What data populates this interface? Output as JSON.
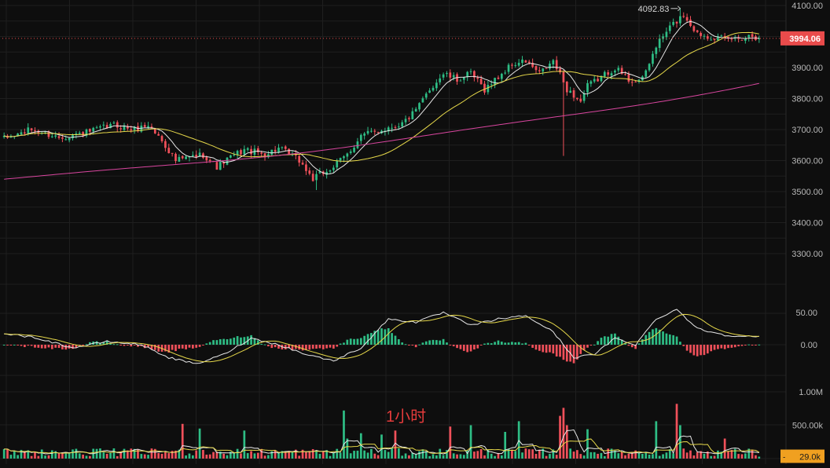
{
  "colors": {
    "background": "#0e0e0e",
    "grid": "#1f1f1f",
    "axis_text": "#b8b8b8",
    "up": "#2ebd85",
    "down": "#f0505a",
    "ma_fast": "#e8e8e8",
    "ma_mid": "#e6d84a",
    "ma_slow": "#d9469f",
    "price_tag": "#e94b4b",
    "volume_tag": "#f0a020",
    "annotation": "#e33b3b"
  },
  "chart_data": [
    {
      "type": "candlestick",
      "panel": "price",
      "y_ticks": [
        "4100.00",
        "4000.00",
        "3900.00",
        "3800.00",
        "3700.00",
        "3600.00",
        "3500.00",
        "3400.00",
        "3300.00"
      ],
      "ylim": [
        3215,
        4100
      ],
      "grid": true,
      "high_marker_label": "4092.83",
      "last_price_label": "3994.06",
      "anchors": [
        [
          0,
          3670
        ],
        [
          8,
          3700
        ],
        [
          16,
          3675
        ],
        [
          24,
          3690
        ],
        [
          32,
          3715
        ],
        [
          38,
          3700
        ],
        [
          42,
          3715
        ],
        [
          46,
          3665
        ],
        [
          50,
          3600
        ],
        [
          54,
          3610
        ],
        [
          58,
          3620
        ],
        [
          62,
          3580
        ],
        [
          66,
          3610
        ],
        [
          70,
          3635
        ],
        [
          76,
          3620
        ],
        [
          80,
          3640
        ],
        [
          86,
          3600
        ],
        [
          90,
          3540
        ],
        [
          96,
          3580
        ],
        [
          100,
          3620
        ],
        [
          104,
          3680
        ],
        [
          110,
          3700
        ],
        [
          116,
          3720
        ],
        [
          120,
          3760
        ],
        [
          124,
          3830
        ],
        [
          128,
          3880
        ],
        [
          132,
          3860
        ],
        [
          136,
          3880
        ],
        [
          140,
          3830
        ],
        [
          144,
          3870
        ],
        [
          148,
          3910
        ],
        [
          152,
          3920
        ],
        [
          156,
          3880
        ],
        [
          160,
          3920
        ],
        [
          164,
          3830
        ],
        [
          168,
          3790
        ],
        [
          170,
          3840
        ],
        [
          174,
          3870
        ],
        [
          178,
          3900
        ],
        [
          182,
          3860
        ],
        [
          186,
          3860
        ],
        [
          190,
          3970
        ],
        [
          194,
          4030
        ],
        [
          198,
          4070
        ],
        [
          202,
          4010
        ],
        [
          206,
          4000
        ],
        [
          210,
          3990
        ],
        [
          214,
          3995
        ],
        [
          218,
          4005
        ],
        [
          220,
          3994.06
        ]
      ],
      "n_bars": 221,
      "special_wicks": [
        {
          "bar": 163,
          "low": 3615
        },
        {
          "bar": 91,
          "low": 3505
        },
        {
          "bar": 197,
          "high": 4092.83
        }
      ],
      "moving_averages": [
        {
          "kind": "fast",
          "period": 7
        },
        {
          "kind": "mid",
          "period": 25
        },
        {
          "kind": "slow",
          "period": 99,
          "start": 3540,
          "end": 3850
        }
      ]
    },
    {
      "type": "macd",
      "panel": "macd",
      "y_ticks": [
        "50.00",
        "0.00"
      ],
      "ylim": [
        -55,
        80
      ],
      "anchors": [
        [
          0,
          18
        ],
        [
          10,
          10
        ],
        [
          20,
          -5
        ],
        [
          30,
          5
        ],
        [
          40,
          0
        ],
        [
          48,
          -20
        ],
        [
          56,
          -30
        ],
        [
          64,
          -15
        ],
        [
          72,
          10
        ],
        [
          80,
          0
        ],
        [
          88,
          -15
        ],
        [
          96,
          -25
        ],
        [
          104,
          -5
        ],
        [
          112,
          40
        ],
        [
          120,
          35
        ],
        [
          128,
          50
        ],
        [
          136,
          30
        ],
        [
          144,
          40
        ],
        [
          152,
          45
        ],
        [
          160,
          20
        ],
        [
          166,
          -20
        ],
        [
          172,
          -15
        ],
        [
          178,
          10
        ],
        [
          184,
          0
        ],
        [
          190,
          40
        ],
        [
          196,
          55
        ],
        [
          202,
          25
        ],
        [
          210,
          15
        ],
        [
          220,
          12
        ]
      ]
    },
    {
      "type": "bar",
      "panel": "volume",
      "y_ticks": [
        "1.00M",
        "500.00k"
      ],
      "ylim": [
        0,
        1150000
      ],
      "last_volume_label": "29.0k",
      "annotation": "1小时",
      "base_volume": 90000,
      "spikes": [
        [
          52,
          520000
        ],
        [
          57,
          450000
        ],
        [
          70,
          420000
        ],
        [
          99,
          720000
        ],
        [
          100,
          300000
        ],
        [
          104,
          380000
        ],
        [
          110,
          360000
        ],
        [
          114,
          420000
        ],
        [
          130,
          480000
        ],
        [
          136,
          500000
        ],
        [
          146,
          400000
        ],
        [
          150,
          560000
        ],
        [
          162,
          640000
        ],
        [
          163,
          760000
        ],
        [
          164,
          500000
        ],
        [
          170,
          440000
        ],
        [
          190,
          560000
        ],
        [
          196,
          820000
        ],
        [
          197,
          500000
        ],
        [
          210,
          300000
        ]
      ]
    }
  ]
}
